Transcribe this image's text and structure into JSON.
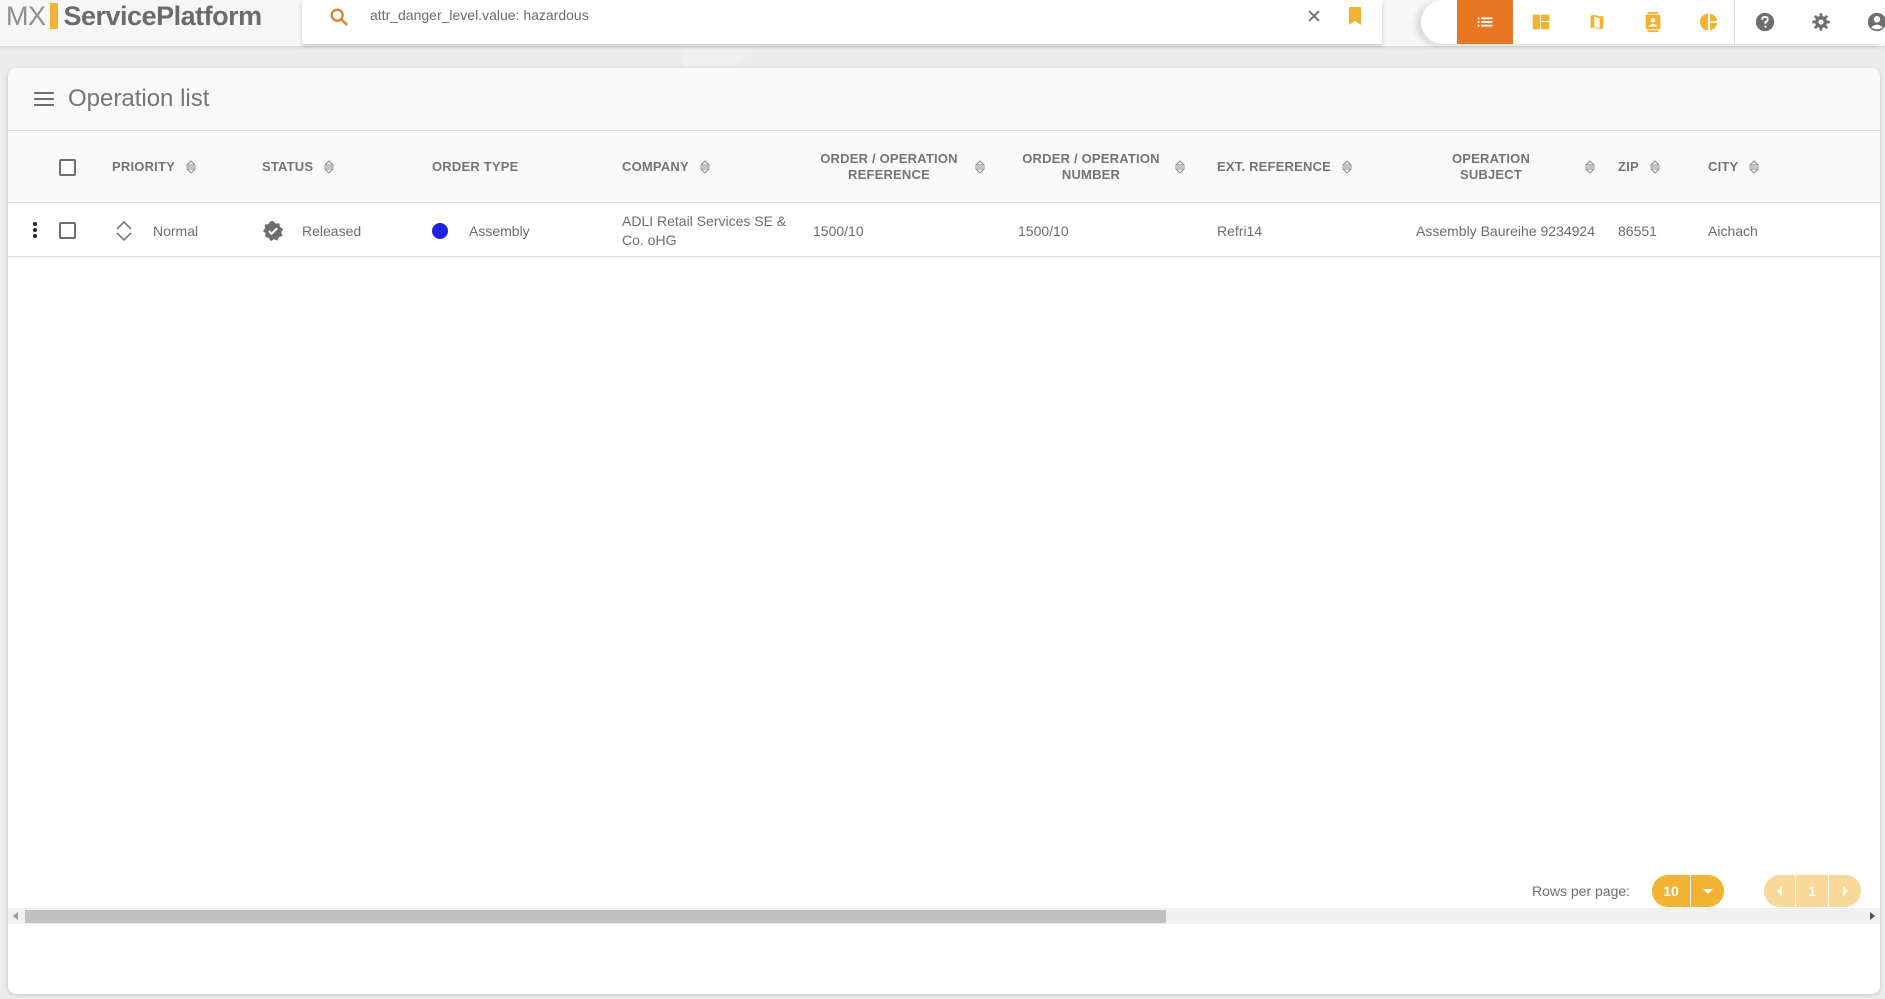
{
  "app": {
    "logo_prefix": "MX",
    "logo_name": "ServicePlatform"
  },
  "search": {
    "query": "attr_danger_level.value: hazardous",
    "icons": {
      "search": "search-icon",
      "clear": "close-icon",
      "bookmark": "bookmark-icon"
    }
  },
  "nav": {
    "items": [
      {
        "name": "list-view",
        "icon": "list-icon",
        "active": true
      },
      {
        "name": "dashboard-view",
        "icon": "dashboard-icon",
        "active": false
      },
      {
        "name": "map-view",
        "icon": "map-icon",
        "active": false
      },
      {
        "name": "contacts-view",
        "icon": "contact-card-icon",
        "active": false
      },
      {
        "name": "chart-view",
        "icon": "pie-chart-icon",
        "active": false
      }
    ],
    "utility": [
      {
        "name": "help",
        "icon": "help-icon"
      },
      {
        "name": "settings",
        "icon": "gear-icon"
      },
      {
        "name": "account",
        "icon": "account-icon"
      }
    ],
    "colors": {
      "active_bg": "#e87722",
      "icon_accent": "#f2b333",
      "icon_neutral": "#6e6e6e"
    }
  },
  "page": {
    "title": "Operation list"
  },
  "table": {
    "columns": [
      {
        "label": "PRIORITY",
        "sortable": true
      },
      {
        "label": "STATUS",
        "sortable": true
      },
      {
        "label": "ORDER TYPE",
        "sortable": false
      },
      {
        "label": "COMPANY",
        "sortable": true
      },
      {
        "label": "ORDER / OPERATION REFERENCE",
        "sortable": true
      },
      {
        "label": "ORDER / OPERATION NUMBER",
        "sortable": true
      },
      {
        "label": "EXT. REFERENCE",
        "sortable": true
      },
      {
        "label": "OPERATION SUBJECT",
        "sortable": true
      },
      {
        "label": "ZIP",
        "sortable": true
      },
      {
        "label": "CITY",
        "sortable": true
      }
    ],
    "rows": [
      {
        "priority": "Normal",
        "status": "Released",
        "order_type": "Assembly",
        "order_type_color": "#2121e0",
        "company": "ADLI Retail Services SE & Co. oHG",
        "order_operation_reference": "1500/10",
        "order_operation_number": "1500/10",
        "ext_reference": "Refri14",
        "operation_subject": "Assembly Baureihe 9234924",
        "zip": "86551",
        "city": "Aichach"
      }
    ]
  },
  "footer": {
    "rows_per_page_label": "Rows per page:",
    "rows_per_page_value": "10",
    "current_page": "1"
  }
}
